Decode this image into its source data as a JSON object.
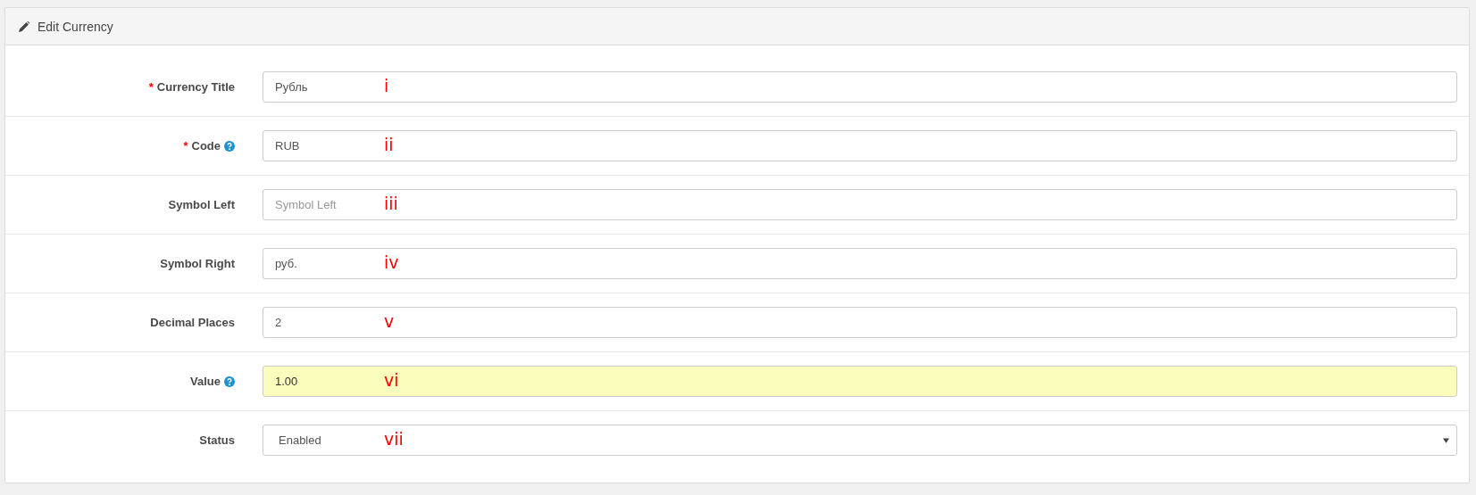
{
  "panel": {
    "title": "Edit Currency"
  },
  "fields": [
    {
      "kind": "text",
      "required_mark": "*",
      "label": "Currency Title",
      "help": false,
      "value": "Рубль",
      "highlighted": false,
      "annotation": "i"
    },
    {
      "kind": "text",
      "required_mark": "*",
      "label": "Code",
      "help": true,
      "value": "RUB",
      "highlighted": false,
      "annotation": "ii"
    },
    {
      "kind": "text",
      "label": "Symbol Left",
      "help": false,
      "placeholder": "Symbol Left",
      "highlighted": false,
      "annotation": "iii"
    },
    {
      "kind": "text",
      "label": "Symbol Right",
      "help": false,
      "value": "руб.",
      "highlighted": false,
      "annotation": "iv"
    },
    {
      "kind": "text",
      "label": "Decimal Places",
      "help": false,
      "value": "2",
      "highlighted": false,
      "annotation": "v"
    },
    {
      "kind": "text",
      "label": "Value",
      "help": true,
      "value": "1.00",
      "highlighted": true,
      "annotation": "vi"
    },
    {
      "kind": "select",
      "label": "Status",
      "help": false,
      "value": "Enabled",
      "highlighted": false,
      "annotation": "vii"
    }
  ]
}
